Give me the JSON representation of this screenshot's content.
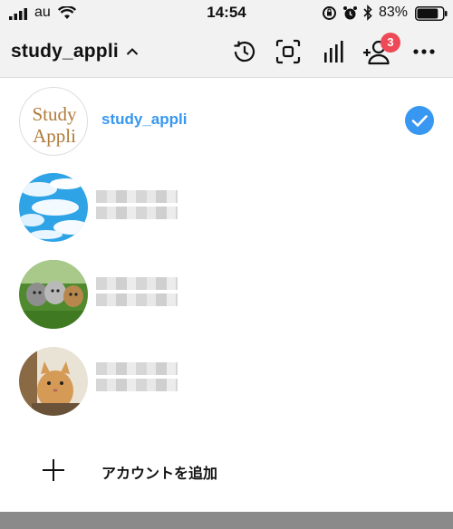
{
  "status_bar": {
    "carrier": "au",
    "time": "14:54",
    "battery_percent": "83%",
    "battery_level": 0.83,
    "icons": [
      "signal-icon",
      "wifi-icon",
      "orientation-lock-icon",
      "alarm-icon",
      "bluetooth-icon",
      "battery-icon"
    ]
  },
  "header": {
    "account_name": "study_appli",
    "icons": [
      "history-icon",
      "scan-icon",
      "insights-icon",
      "add-user-icon",
      "more-icon"
    ],
    "notification_count": "3",
    "badge_color": "#ed4956"
  },
  "accounts": [
    {
      "username": "study_appli",
      "avatar_text_1": "Study",
      "avatar_text_2": "Appli",
      "selected": true
    },
    {
      "username": "",
      "avatar": "sky-clouds",
      "selected": false
    },
    {
      "username": "",
      "avatar": "kittens-on-grass",
      "selected": false
    },
    {
      "username": "",
      "avatar": "cat-portrait",
      "selected": false
    }
  ],
  "add_account": {
    "label": "アカウントを追加"
  },
  "colors": {
    "link_blue": "#3897f0",
    "check_blue": "#3897f0"
  }
}
